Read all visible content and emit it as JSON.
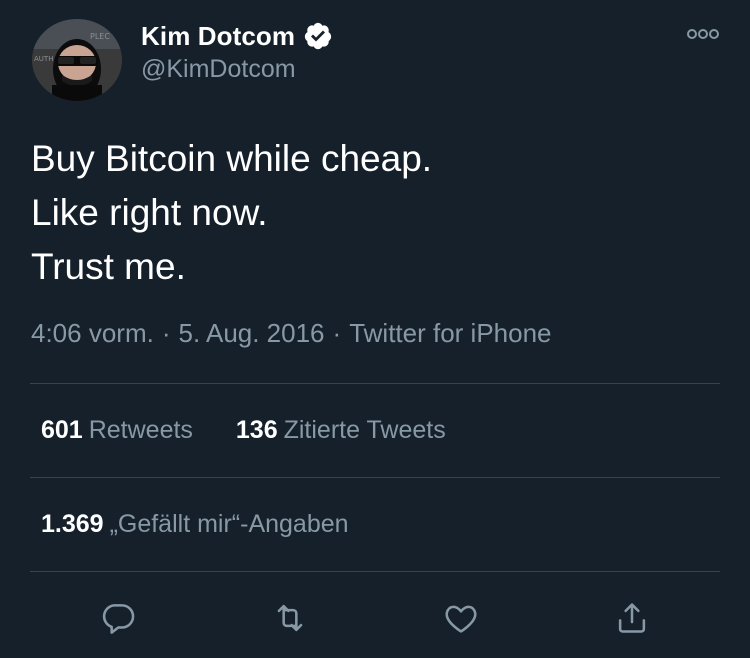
{
  "user": {
    "display_name": "Kim Dotcom",
    "handle": "@KimDotcom",
    "verified": true,
    "avatar_icon": "avatar-kim-dotcom"
  },
  "tweet": {
    "text_lines": [
      "Buy Bitcoin while cheap.",
      "Like right now.",
      "Trust me."
    ],
    "time": "4:06 vorm.",
    "date": "5. Aug. 2016",
    "client": "Twitter for iPhone"
  },
  "stats": {
    "retweets_count": "601",
    "retweets_label": "Retweets",
    "quotes_count": "136",
    "quotes_label": "Zitierte Tweets",
    "likes_count": "1.369",
    "likes_label": "„Gefällt mir“-Angaben"
  },
  "actions": {
    "reply_icon": "reply-icon",
    "retweet_icon": "retweet-icon",
    "like_icon": "heart-icon",
    "share_icon": "share-icon"
  },
  "colors": {
    "background": "#15202b",
    "primary_text": "#ffffff",
    "secondary_text": "#8899a6",
    "divider": "#38444d",
    "verified_badge": "#ffffff"
  }
}
